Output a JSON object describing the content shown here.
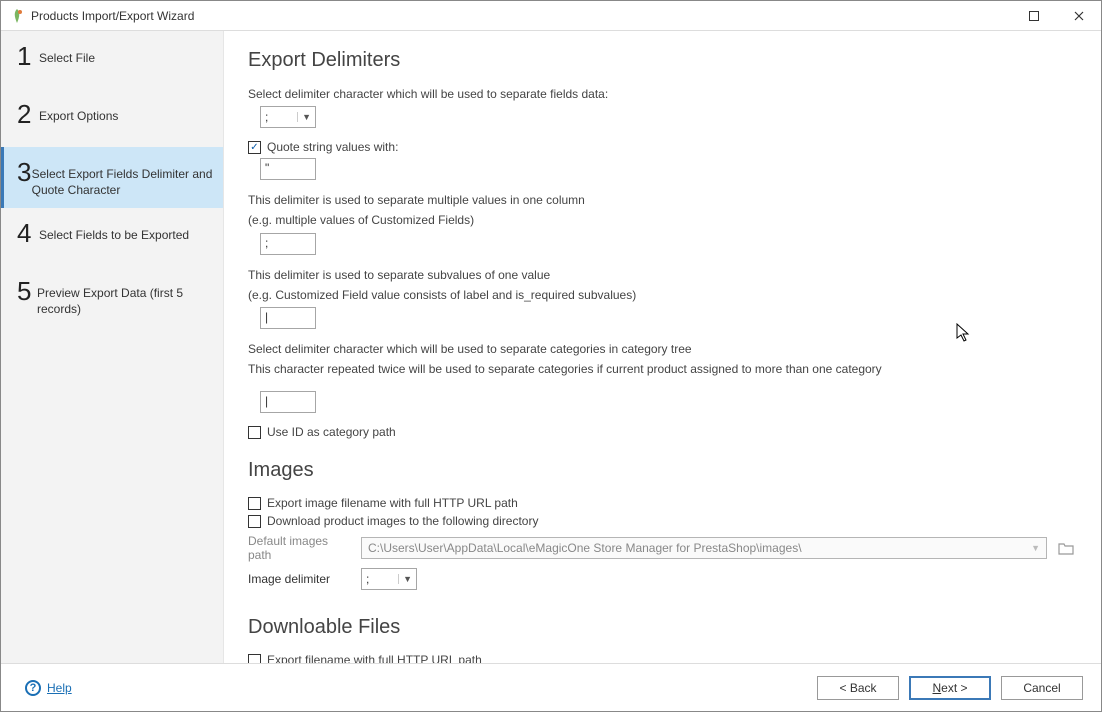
{
  "window": {
    "title": "Products Import/Export Wizard"
  },
  "sidebar": {
    "steps": [
      {
        "num": "1",
        "label": "Select File"
      },
      {
        "num": "2",
        "label": "Export Options"
      },
      {
        "num": "3",
        "label": "Select Export Fields Delimiter and Quote Character"
      },
      {
        "num": "4",
        "label": "Select Fields to be Exported"
      },
      {
        "num": "5",
        "label": "Preview Export Data (first 5 records)"
      }
    ],
    "active_index": 2
  },
  "delimiters": {
    "heading": "Export Delimiters",
    "field_desc": "Select delimiter character which will be used to separate fields data:",
    "field_value": ";",
    "quote_checkbox_label": "Quote string values with:",
    "quote_checked": true,
    "quote_value": "\"",
    "multival_desc1": "This delimiter is used to separate multiple values in one column",
    "multival_desc2": "(e.g. multiple values of Customized Fields)",
    "multival_value": ";",
    "subval_desc1": "This delimiter is used to separate subvalues of one value",
    "subval_desc2": "(e.g. Customized Field value consists of label and is_required subvalues)",
    "subval_value": "|",
    "cat_desc1": "Select delimiter character which will be used to separate categories in category tree",
    "cat_desc2": "This character repeated twice will be used to separate categories if current product assigned to more than one category",
    "cat_value": "|",
    "use_id_label": "Use ID as category path",
    "use_id_checked": false
  },
  "images": {
    "heading": "Images",
    "export_full_url_label": "Export image filename with full HTTP URL path",
    "export_full_url_checked": false,
    "download_dir_label": "Download product images to the following directory",
    "download_dir_checked": false,
    "default_path_label": "Default images path",
    "default_path_value": "C:\\Users\\User\\AppData\\Local\\eMagicOne Store Manager for PrestaShop\\images\\",
    "img_delim_label": "Image delimiter",
    "img_delim_value": ";"
  },
  "downloadable": {
    "heading": "Downloable Files",
    "export_full_url_label": "Export filename with full HTTP URL path",
    "export_full_url_checked": false
  },
  "footer": {
    "help_label": "Help",
    "back_label": "< Back",
    "next_label": "Next >",
    "cancel_label": "Cancel"
  }
}
